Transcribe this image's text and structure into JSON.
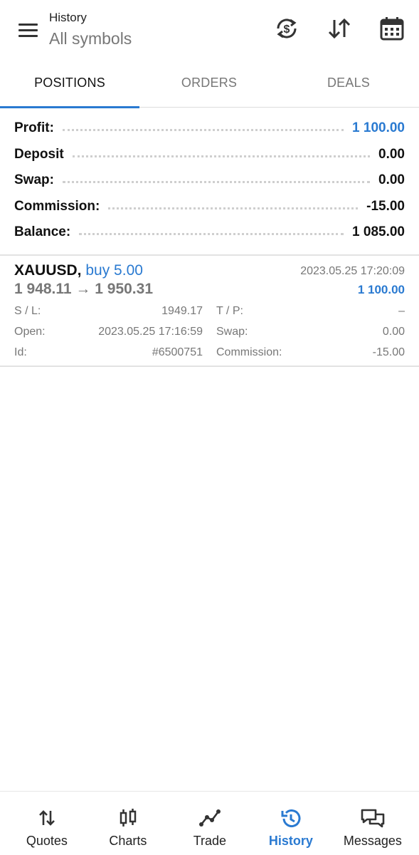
{
  "header": {
    "title": "History",
    "subtitle": "All symbols",
    "icons": [
      "menu-icon",
      "currency-exchange-icon",
      "sort-icon",
      "calendar-icon"
    ]
  },
  "tabs": [
    {
      "label": "POSITIONS",
      "active": true
    },
    {
      "label": "ORDERS",
      "active": false
    },
    {
      "label": "DEALS",
      "active": false
    }
  ],
  "summary": [
    {
      "label": "Profit:",
      "value": "1 100.00",
      "highlight": true
    },
    {
      "label": "Deposit",
      "value": "0.00",
      "highlight": false
    },
    {
      "label": "Swap:",
      "value": "0.00",
      "highlight": false
    },
    {
      "label": "Commission:",
      "value": "-15.00",
      "highlight": false
    },
    {
      "label": "Balance:",
      "value": "1 085.00",
      "highlight": false
    }
  ],
  "position": {
    "symbol": "XAUUSD,",
    "action": "buy 5.00",
    "prices": "1 948.11 → 1 950.31",
    "close_time": "2023.05.25 17:20:09",
    "profit": "1 100.00",
    "sl_label": "S / L:",
    "sl_value": "1949.17",
    "tp_label": "T / P:",
    "tp_value": "–",
    "open_label": "Open:",
    "open_value": "2023.05.25 17:16:59",
    "swap_label": "Swap:",
    "swap_value": "0.00",
    "id_label": "Id:",
    "id_value": "#6500751",
    "commission_label": "Commission:",
    "commission_value": "-15.00"
  },
  "bottom_nav": [
    {
      "label": "Quotes",
      "icon": "quotes-arrows-icon",
      "active": false
    },
    {
      "label": "Charts",
      "icon": "candlestick-icon",
      "active": false
    },
    {
      "label": "Trade",
      "icon": "trade-line-icon",
      "active": false
    },
    {
      "label": "History",
      "icon": "history-clock-icon",
      "active": true
    },
    {
      "label": "Messages",
      "icon": "messages-icon",
      "active": false
    }
  ],
  "colors": {
    "accent": "#2a7ad1",
    "text": "#111111",
    "muted": "#777777"
  }
}
